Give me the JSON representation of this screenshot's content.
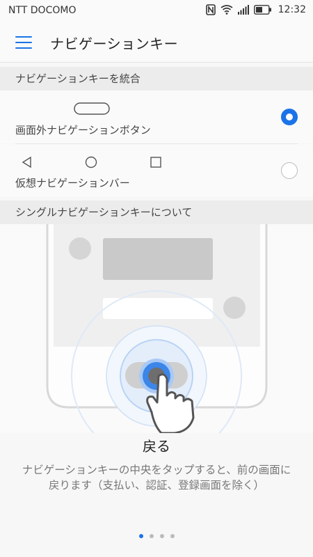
{
  "status": {
    "carrier": "NTT DOCOMO",
    "time": "12:32",
    "icons": [
      "nfc-icon",
      "wifi-icon",
      "signal-icon",
      "battery-icon"
    ]
  },
  "appbar": {
    "title": "ナビゲーションキー",
    "menu_icon": "hamburger-icon"
  },
  "section1": {
    "title": "ナビゲーションキーを統合"
  },
  "options": [
    {
      "label": "画面外ナビゲーションボタン",
      "selected": true
    },
    {
      "label": "仮想ナビゲーションバー",
      "selected": false
    }
  ],
  "section2": {
    "title": "シングルナビゲーションキーについて"
  },
  "tutorial": {
    "title": "戻る",
    "description": "ナビゲーションキーの中央をタップすると、前の画面に戻ります（支払い、認証、登録画面を除く）",
    "page_count": 4,
    "current_page": 1
  },
  "colors": {
    "accent": "#1a73e8"
  }
}
